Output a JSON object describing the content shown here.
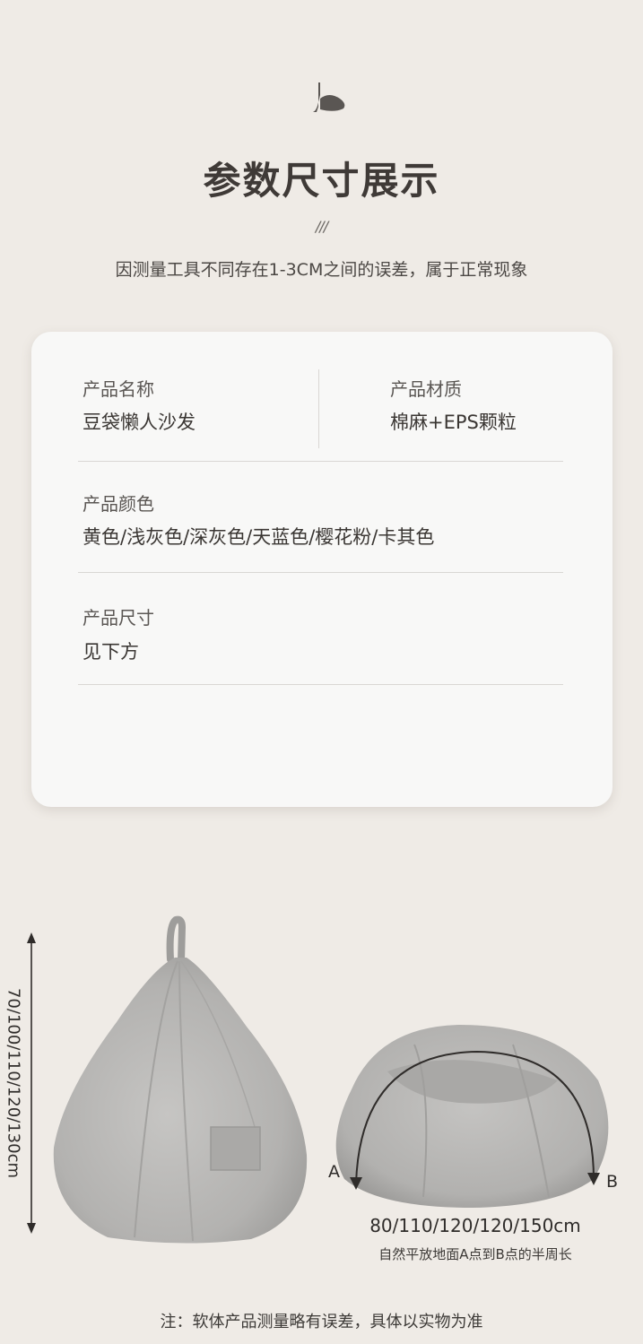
{
  "header": {
    "title": "参数尺寸展示",
    "slashes": "///",
    "subtitle": "因测量工具不同存在1-3CM之间的误差，属于正常现象"
  },
  "specs": {
    "name_label": "产品名称",
    "name_value": "豆袋懒人沙发",
    "material_label": "产品材质",
    "material_value": "棉麻+EPS颗粒",
    "color_label": "产品颜色",
    "color_value": "黄色/浅灰色/深灰色/天蓝色/樱花粉/卡其色",
    "size_label": "产品尺寸",
    "size_value": "见下方"
  },
  "dimensions": {
    "height_text": "70/100/110/120/130cm",
    "point_a": "A",
    "point_b": "B",
    "width_text": "80/110/120/120/150cm",
    "width_note": "自然平放地面A点到B点的半周长"
  },
  "footer": {
    "note": "注：软体产品测量略有误差，具体以实物为准"
  },
  "colors": {
    "background": "#efebe6",
    "card": "#f8f8f7",
    "bag_gray": "#b9b8b6",
    "text_dark": "#3f3a37"
  }
}
